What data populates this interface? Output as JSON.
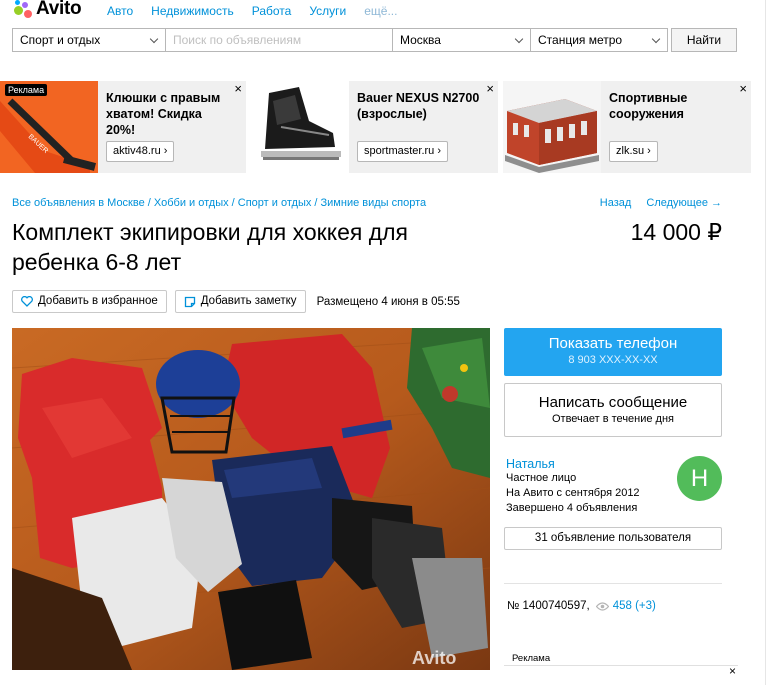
{
  "header": {
    "logo_text": "Avito",
    "nav": [
      "Авто",
      "Недвижимость",
      "Работа",
      "Услуги",
      "ещё..."
    ]
  },
  "search": {
    "category": "Спорт и отдых",
    "placeholder": "Поиск по объявлениям",
    "city": "Москва",
    "metro": "Станция метро",
    "button": "Найти"
  },
  "ads": {
    "badge": "Реклама",
    "items": [
      {
        "title": "Клюшки с правым хватом! Скидка 20%!",
        "link": "aktiv48.ru ›"
      },
      {
        "title": "Bauer NEXUS N2700 (взрослые)",
        "link": "sportmaster.ru ›"
      },
      {
        "title": "Спортивные сооружения",
        "link": "zlk.su ›"
      }
    ],
    "close": "×"
  },
  "breadcrumbs": [
    "Все объявления в Москве",
    "Хобби и отдых",
    "Спорт и отдых",
    "Зимние виды спорта"
  ],
  "breadcrumb_sep": " / ",
  "pager": {
    "back": "Назад",
    "next": "Следующее →"
  },
  "listing": {
    "title": "Комплект экипировки для хоккея для ребенка 6-8 лет",
    "price": "14 000 ₽",
    "fav_button": "Добавить в избранное",
    "note_button": "Добавить заметку",
    "posted": "Размещено 4 июня в 05:55",
    "photo_watermark": "Avito"
  },
  "sidebar": {
    "phone_label": "Показать телефон",
    "phone_masked": "8 903 XXX-XX-XX",
    "msg_label": "Написать сообщение",
    "msg_sub": "Отвечает в течение дня",
    "seller_name": "Наталья",
    "seller_type": "Частное лицо",
    "seller_since": "На Авито с сентября 2012",
    "seller_completed": "Завершено 4 объявления",
    "avatar_letter": "Н",
    "user_ads": "31 объявление пользователя",
    "ad_number": "№ 1400740597,",
    "views": "458 (+3)",
    "reklama": "Реклама"
  },
  "colors": {
    "link": "#0091d9",
    "phone_button": "#23a5f0",
    "avatar": "#52bc5a"
  }
}
